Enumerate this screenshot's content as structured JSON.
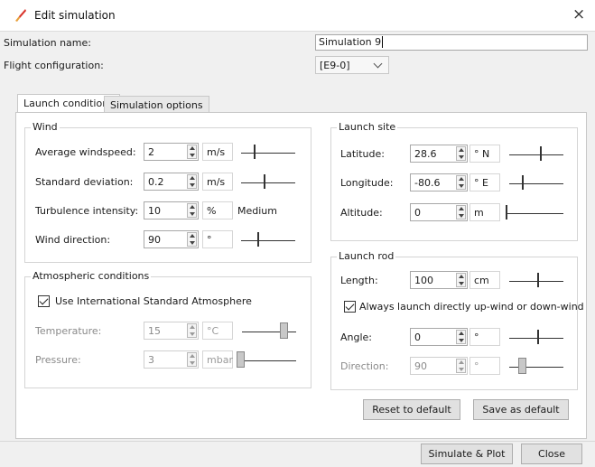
{
  "window": {
    "title": "Edit simulation",
    "close": "×"
  },
  "simulation_name": {
    "label": "Simulation name:",
    "value": "Simulation 9"
  },
  "flight_configuration": {
    "label": "Flight configuration:",
    "value": "[E9-0]"
  },
  "tabs": [
    {
      "label": "Launch conditions",
      "active": true
    },
    {
      "label": "Simulation options",
      "active": false
    }
  ],
  "wind": {
    "title": "Wind",
    "average_windspeed": {
      "label": "Average windspeed:",
      "value": "2",
      "unit": "m/s"
    },
    "standard_deviation": {
      "label": "Standard deviation:",
      "value": "0.2",
      "unit": "m/s"
    },
    "turbulence_intensity": {
      "label": "Turbulence intensity:",
      "value": "10",
      "unit": "%",
      "level": "Medium"
    },
    "wind_direction": {
      "label": "Wind direction:",
      "value": "90",
      "unit": "°"
    }
  },
  "atmospheric": {
    "title": "Atmospheric conditions",
    "isa_checkbox": {
      "label": "Use International Standard Atmosphere",
      "checked": true
    },
    "temperature": {
      "label": "Temperature:",
      "value": "15",
      "unit": "°C"
    },
    "pressure": {
      "label": "Pressure:",
      "value": "3",
      "unit": "mbar"
    }
  },
  "launch_site": {
    "title": "Launch site",
    "latitude": {
      "label": "Latitude:",
      "value": "28.6",
      "unit": "° N"
    },
    "longitude": {
      "label": "Longitude:",
      "value": "-80.6",
      "unit": "° E"
    },
    "altitude": {
      "label": "Altitude:",
      "value": "0",
      "unit": "m"
    }
  },
  "launch_rod": {
    "title": "Launch rod",
    "length": {
      "label": "Length:",
      "value": "100",
      "unit": "cm"
    },
    "upwind_checkbox": {
      "label": "Always launch directly up-wind or down-wind",
      "checked": true
    },
    "angle": {
      "label": "Angle:",
      "value": "0",
      "unit": "°"
    },
    "direction": {
      "label": "Direction:",
      "value": "90",
      "unit": "°"
    }
  },
  "buttons": {
    "reset_default": "Reset to default",
    "save_default": "Save as default",
    "simulate_plot": "Simulate & Plot",
    "close": "Close"
  },
  "colors": {
    "window_bg": "#f0f0f0",
    "panel_bg": "#ffffff",
    "icon_red": "#d9332b"
  }
}
